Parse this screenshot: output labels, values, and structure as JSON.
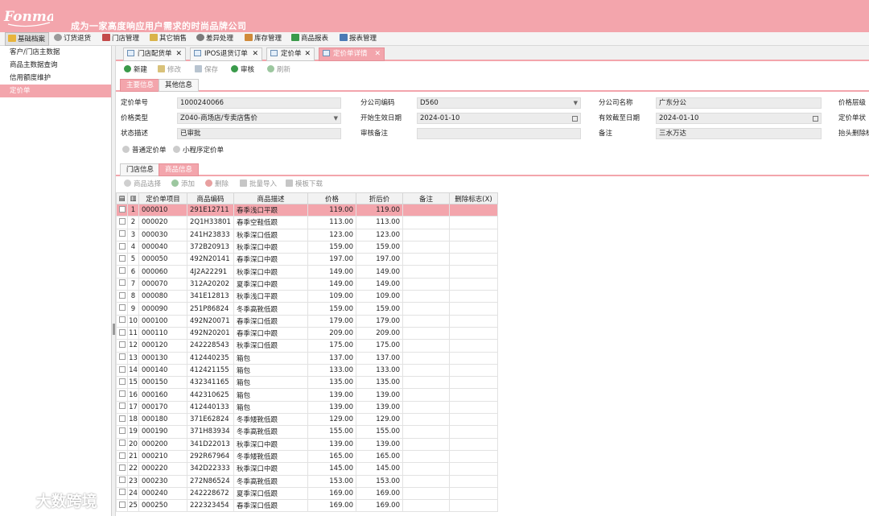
{
  "header": {
    "logo_text": "Fonmay",
    "slogan": "成为一家高度响应用户需求的时尚品牌公司",
    "brand_color": "#f3a5ac"
  },
  "menu": [
    {
      "label": "基础档案",
      "icon": "folder-icon",
      "color": "#e8b43c"
    },
    {
      "label": "订货退货",
      "icon": "gear-icon",
      "color": "#9a9a9a"
    },
    {
      "label": "门店管理",
      "icon": "store-icon",
      "color": "#c44b4b"
    },
    {
      "label": "其它销售",
      "icon": "cup-icon",
      "color": "#d9b34a"
    },
    {
      "label": "差异处理",
      "icon": "clock-icon",
      "color": "#7b7b7b"
    },
    {
      "label": "库存管理",
      "icon": "box-icon",
      "color": "#d08a3a"
    },
    {
      "label": "商品报表",
      "icon": "chart-icon",
      "color": "#3a9a4a"
    },
    {
      "label": "报表管理",
      "icon": "report-icon",
      "color": "#4a7ab5"
    }
  ],
  "sidebar": {
    "items": [
      "客户/门店主数据",
      "商品主数据查询",
      "信用额度维护",
      "定价单"
    ]
  },
  "tabs": [
    {
      "label": "门店配货单",
      "close": "✕"
    },
    {
      "label": "IPOS退货订单",
      "close": "✕"
    },
    {
      "label": "定价单",
      "close": "✕"
    },
    {
      "label": "定价单详情",
      "close": "✕"
    }
  ],
  "toolbar": {
    "new": "新建",
    "edit": "修改",
    "save": "保存",
    "audit": "审核",
    "refresh": "刷新"
  },
  "subtabs": [
    "主要信息",
    "其他信息"
  ],
  "form": {
    "price_no_label": "定价单号",
    "price_no": "1000240066",
    "branch_code_label": "分公司编码",
    "branch_code": "D560",
    "branch_name_label": "分公司名称",
    "branch_name": "广东分公",
    "price_level_label": "价格层级",
    "price_type_label": "价格类型",
    "price_type": "Z040-商场店/专卖店售价",
    "start_date_label": "开始生效日期",
    "start_date": "2024-01-10",
    "end_date_label": "有效截至日期",
    "end_date": "2024-01-10",
    "price_status_label": "定价单状",
    "status_desc_label": "状态描述",
    "status_desc": "已审批",
    "audit_note_label": "审核备注",
    "audit_note": "",
    "note_label": "备注",
    "note": "三水万达",
    "header_delete_label": "抬头删除标",
    "radio_normal": "普通定价单",
    "radio_mini": "小程序定价单"
  },
  "grid_tabs": [
    "门店信息",
    "商品信息"
  ],
  "grid_toolbar": {
    "select": "商品选择",
    "add": "添加",
    "delete": "删除",
    "import": "批量导入",
    "download": "模板下载"
  },
  "columns": [
    "定价单项目",
    "商品编码",
    "商品描述",
    "价格",
    "折后价",
    "备注",
    "删除标志(X)"
  ],
  "rows": [
    [
      "1",
      "000010",
      "291E12711",
      "春季浅口平跟",
      "119.00",
      "119.00"
    ],
    [
      "2",
      "000020",
      "2Q1H33801",
      "春季空鞋低跟",
      "113.00",
      "113.00"
    ],
    [
      "3",
      "000030",
      "241H23833",
      "秋季深口低跟",
      "123.00",
      "123.00"
    ],
    [
      "4",
      "000040",
      "372B20913",
      "秋季深口中跟",
      "159.00",
      "159.00"
    ],
    [
      "5",
      "000050",
      "492N20141",
      "春季深口中跟",
      "197.00",
      "197.00"
    ],
    [
      "6",
      "000060",
      "4J2A22291",
      "秋季深口中跟",
      "149.00",
      "149.00"
    ],
    [
      "7",
      "000070",
      "312A20202",
      "夏季深口中跟",
      "149.00",
      "149.00"
    ],
    [
      "8",
      "000080",
      "341E12813",
      "秋季浅口平跟",
      "109.00",
      "109.00"
    ],
    [
      "9",
      "000090",
      "251P86824",
      "冬季高靴低跟",
      "159.00",
      "159.00"
    ],
    [
      "10",
      "000100",
      "492N20071",
      "春季深口低跟",
      "179.00",
      "179.00"
    ],
    [
      "11",
      "000110",
      "492N20201",
      "春季深口中跟",
      "209.00",
      "209.00"
    ],
    [
      "12",
      "000120",
      "242228543",
      "秋季深口低跟",
      "175.00",
      "175.00"
    ],
    [
      "13",
      "000130",
      "412440235",
      "箱包",
      "137.00",
      "137.00"
    ],
    [
      "14",
      "000140",
      "412421155",
      "箱包",
      "133.00",
      "133.00"
    ],
    [
      "15",
      "000150",
      "432341165",
      "箱包",
      "135.00",
      "135.00"
    ],
    [
      "16",
      "000160",
      "442310625",
      "箱包",
      "139.00",
      "139.00"
    ],
    [
      "17",
      "000170",
      "412440133",
      "箱包",
      "139.00",
      "139.00"
    ],
    [
      "18",
      "000180",
      "371E62824",
      "冬季矮靴低跟",
      "129.00",
      "129.00"
    ],
    [
      "19",
      "000190",
      "371H83934",
      "冬季高靴低跟",
      "155.00",
      "155.00"
    ],
    [
      "20",
      "000200",
      "341D22013",
      "秋季深口中跟",
      "139.00",
      "139.00"
    ],
    [
      "21",
      "000210",
      "292R67964",
      "冬季矮靴低跟",
      "165.00",
      "165.00"
    ],
    [
      "22",
      "000220",
      "342D22333",
      "秋季深口中跟",
      "145.00",
      "145.00"
    ],
    [
      "23",
      "000230",
      "272N86524",
      "冬季高靴低跟",
      "153.00",
      "153.00"
    ],
    [
      "24",
      "000240",
      "242228672",
      "夏季深口低跟",
      "169.00",
      "169.00"
    ],
    [
      "25",
      "000250",
      "222323454",
      "春季深口低跟",
      "169.00",
      "169.00"
    ]
  ],
  "watermark": "大数跨境"
}
